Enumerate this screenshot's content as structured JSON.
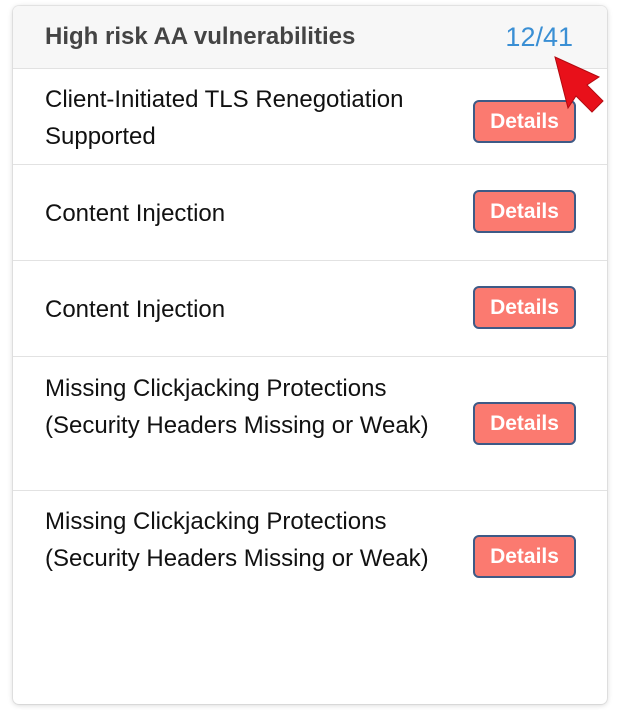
{
  "panel": {
    "title": "High risk AA vulnerabilities",
    "counter": "12/41"
  },
  "rows": [
    {
      "label": "Client-Initiated TLS Renegotiation Supported",
      "button": "Details"
    },
    {
      "label": "Content Injection",
      "button": "Details"
    },
    {
      "label": "Content Injection",
      "button": "Details"
    },
    {
      "label": "Missing Clickjacking Protections (Security Headers Missing or Weak)",
      "button": "Details"
    },
    {
      "label": "Missing Clickjacking Protections (Security Headers Missing or Weak)",
      "button": "Details"
    }
  ],
  "colors": {
    "counter": "#3a8fd4",
    "details_button": "#fb7a70",
    "details_border": "#3e5a86",
    "arrow": "#e8101a"
  },
  "icons": {
    "pointer": "red-arrow-pointer-icon"
  }
}
